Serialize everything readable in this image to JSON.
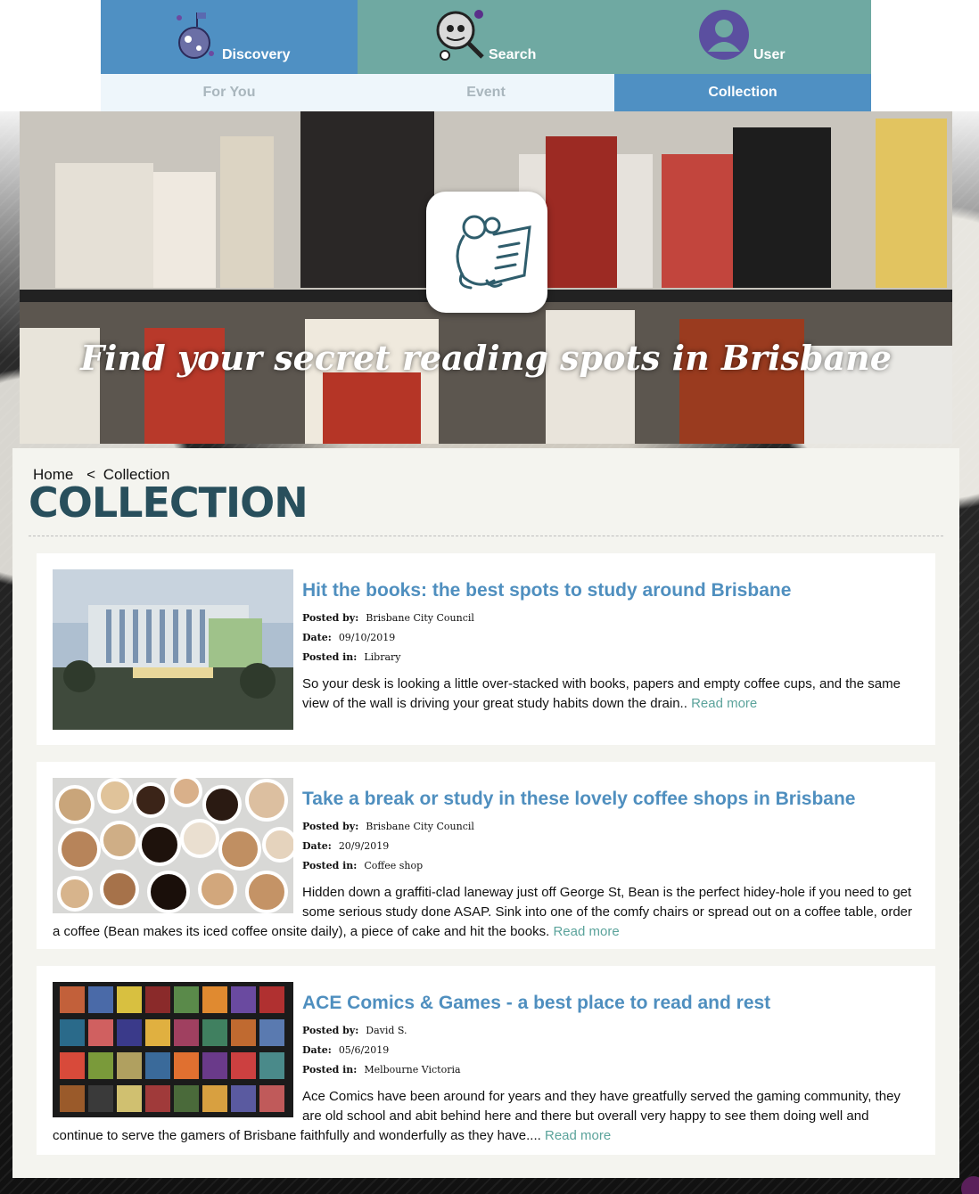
{
  "nav": {
    "tabs": [
      {
        "label": "Discovery",
        "icon": "planet-icon",
        "active": true
      },
      {
        "label": "Search",
        "icon": "magnifier-icon",
        "active": false
      },
      {
        "label": "User",
        "icon": "user-icon",
        "active": false
      }
    ],
    "subtabs": [
      {
        "label": "For You",
        "active": false
      },
      {
        "label": "Event",
        "active": false
      },
      {
        "label": "Collection",
        "active": true
      }
    ]
  },
  "hero": {
    "tagline": "Find your secret reading spots in Brisbane",
    "logo_icon": "reading-mascot-icon"
  },
  "breadcrumb": {
    "home": "Home",
    "separator": "<",
    "current": "Collection"
  },
  "page_title": "Collection",
  "posts": [
    {
      "title": "Hit the books: the best spots to study around Brisbane",
      "posted_by_label": "Posted by:",
      "posted_by": "Brisbane City Council",
      "date_label": "Date:",
      "date": "09/10/2019",
      "posted_in_label": "Posted in:",
      "posted_in": "Library",
      "excerpt": "So your desk is looking a little over-stacked with books, papers and empty coffee cups, and the same view of the wall is driving your great study habits down the drain..",
      "read_more": "Read more",
      "image": "library-photo"
    },
    {
      "title": "Take a break or study in these lovely coffee shops in Brisbane",
      "posted_by_label": "Posted by:",
      "posted_by": "Brisbane City Council",
      "date_label": "Date:",
      "date": "20/9/2019",
      "posted_in_label": "Posted in:",
      "posted_in": "Coffee shop",
      "excerpt": "Hidden down a graffiti-clad laneway just off George St, Bean is the perfect hidey-hole if you need to get some serious study done ASAP. Sink into one of the comfy chairs or spread out on a coffee table, order a coffee (Bean makes its iced coffee onsite daily), a piece of cake and hit the books.",
      "read_more": "Read more",
      "image": "coffee-cups-photo"
    },
    {
      "title": "ACE Comics & Games - a best place to read and rest",
      "posted_by_label": "Posted by:",
      "posted_by": "David S.",
      "date_label": "Date:",
      "date": "05/6/2019",
      "posted_in_label": "Posted in:",
      "posted_in": "Melbourne Victoria",
      "excerpt": "Ace Comics have been around for years and they have greatfully served the gaming community, they are old school and abit behind here and there but overall very happy to see them doing well and continue to serve the gamers of Brisbane faithfully and wonderfully as they have....",
      "read_more": "Read more",
      "image": "comics-shelf-photo"
    }
  ],
  "colors": {
    "nav_teal": "#6fa9a2",
    "nav_blue": "#4f90c3",
    "title_blue": "#4f8fbf",
    "heading_dark": "#284f5c",
    "read_more_green": "#5ba39b"
  }
}
